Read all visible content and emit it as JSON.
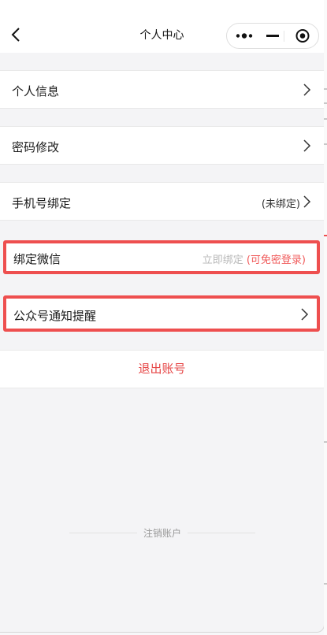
{
  "navbar": {
    "title": "个人中心",
    "back_icon": "chevron-left-icon",
    "capsule": {
      "more_icon": "more-dots-icon",
      "minimize_icon": "minimize-icon",
      "close_icon": "record-close-icon"
    }
  },
  "menu": {
    "personal_info": {
      "label": "个人信息",
      "icon": "chevron-right-icon"
    },
    "password_change": {
      "label": "密码修改",
      "icon": "chevron-right-icon"
    },
    "phone_binding": {
      "label": "手机号绑定",
      "status": "(未绑定)",
      "icon": "chevron-right-icon"
    },
    "wechat_binding": {
      "label": "绑定微信",
      "hint_action": "立即绑定",
      "hint_note": "(可免密登录)"
    },
    "official_account": {
      "label": "公众号通知提醒",
      "icon": "chevron-right-icon"
    }
  },
  "logout": {
    "label": "退出账号"
  },
  "cancel_account": {
    "label": "注销账户"
  },
  "colors": {
    "accent_red": "#e64545",
    "highlight_border": "#ee4f4f",
    "page_bg": "#f4f4f6"
  }
}
